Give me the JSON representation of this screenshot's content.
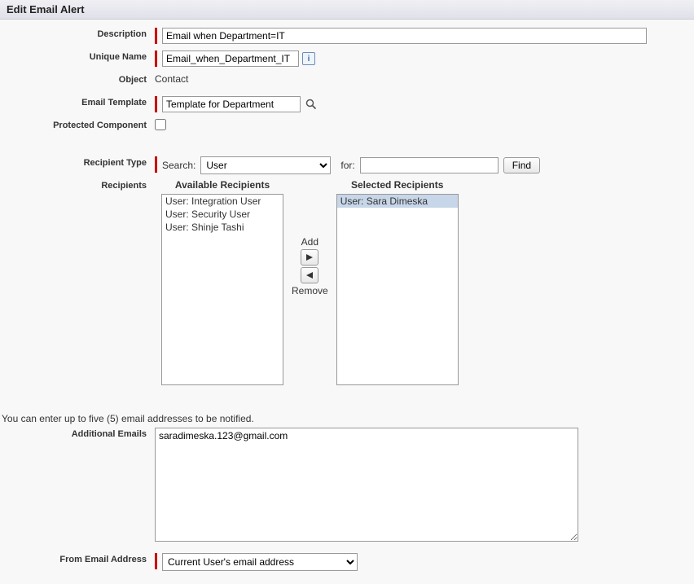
{
  "header": {
    "title": "Edit Email Alert"
  },
  "labels": {
    "description": "Description",
    "unique_name": "Unique Name",
    "object": "Object",
    "email_template": "Email Template",
    "protected_component": "Protected Component",
    "recipient_type": "Recipient Type",
    "recipients": "Recipients",
    "additional_emails": "Additional Emails",
    "from_email": "From Email Address"
  },
  "values": {
    "description": "Email when Department=IT",
    "unique_name": "Email_when_Department_IT",
    "object": "Contact",
    "email_template": "Template for Department",
    "protected_component": false,
    "additional_emails": "saradimeska.123@gmail.com",
    "from_email_selected": "Current User's email address"
  },
  "recipient_type": {
    "search_label": "Search:",
    "search_selected": "User",
    "for_label": "for:",
    "for_value": "",
    "find_label": "Find"
  },
  "duel": {
    "available_header": "Available Recipients",
    "selected_header": "Selected Recipients",
    "add_label": "Add",
    "remove_label": "Remove",
    "available": [
      "User: Integration User",
      "User: Security User",
      "User: Shinje Tashi"
    ],
    "selected": [
      "User: Sara Dimeska"
    ]
  },
  "note": "You can enter up to five (5) email addresses to be notified.",
  "icons": {
    "info": "i"
  }
}
